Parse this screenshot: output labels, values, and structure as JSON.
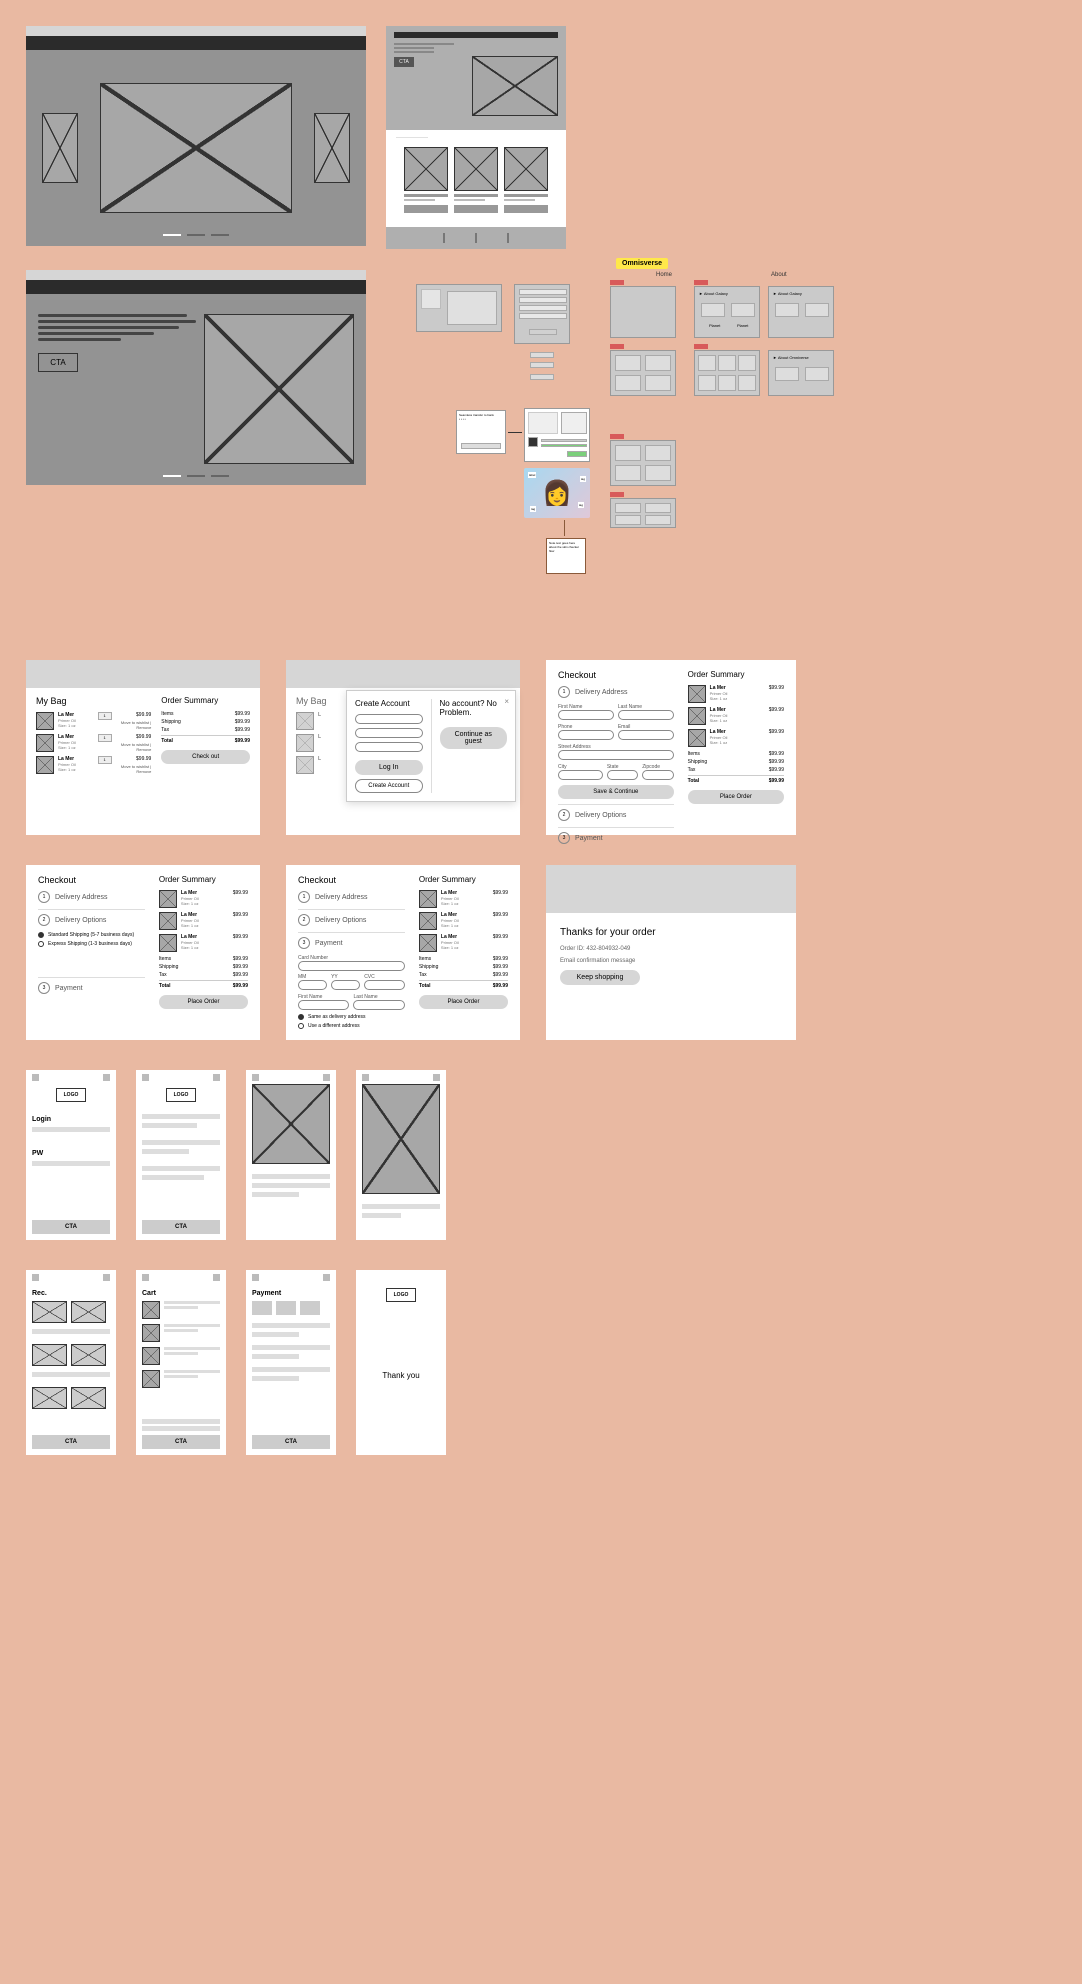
{
  "canvas_label": "Omnisverse",
  "flow_sections": {
    "home": "Home",
    "about": "About"
  },
  "hero_cta": "CTA",
  "mini_cta": "CTA",
  "bag": {
    "title": "My Bag",
    "item": {
      "name": "La Mer",
      "sub": "Primer Oil",
      "size": "Size: 1 oz",
      "qty": "1",
      "price": "$99.99",
      "links": "Move to wishlist | Remove"
    }
  },
  "summary": {
    "title": "Order Summary",
    "items_lbl": "Items",
    "shipping_lbl": "Shipping",
    "tax_lbl": "Tax",
    "total_lbl": "Total",
    "val": "$99.99",
    "checkout_btn": "Check out",
    "place_order_btn": "Place Order"
  },
  "modal": {
    "create_title": "Create Account",
    "login_btn": "Log In",
    "create_btn": "Create Account",
    "noacct_title": "No account? No Problem.",
    "guest_btn": "Continue as guest"
  },
  "checkout": {
    "title": "Checkout",
    "step1": "Delivery Address",
    "step2": "Delivery Options",
    "step3": "Payment",
    "save_btn": "Save & Continue",
    "fields": {
      "first": "First Name",
      "last": "Last Name",
      "phone": "Phone",
      "email": "Email",
      "addr": "Street Address",
      "city": "City",
      "state": "State",
      "zip": "Zipcode"
    },
    "ship_std": "Standard Shipping (5-7 business days)",
    "ship_exp": "Express Shipping (1-3 business days)",
    "pay": {
      "card": "Card Number",
      "mm": "MM",
      "yy": "YY",
      "cvc": "CVC",
      "fname": "First Name",
      "lname": "Last Name",
      "same": "Same as delivery address",
      "diff": "Use a different address"
    }
  },
  "thanks": {
    "title": "Thanks for your order",
    "order_id": "Order ID: 432-804932-049",
    "msg": "Email confirmation message",
    "btn": "Keep shopping"
  },
  "mobile": {
    "logo": "LOGO",
    "login": "Login",
    "pw": "PW",
    "cta": "CTA",
    "rec": "Rec.",
    "cart": "Cart",
    "payment": "Payment",
    "thankyou": "Thank you"
  }
}
